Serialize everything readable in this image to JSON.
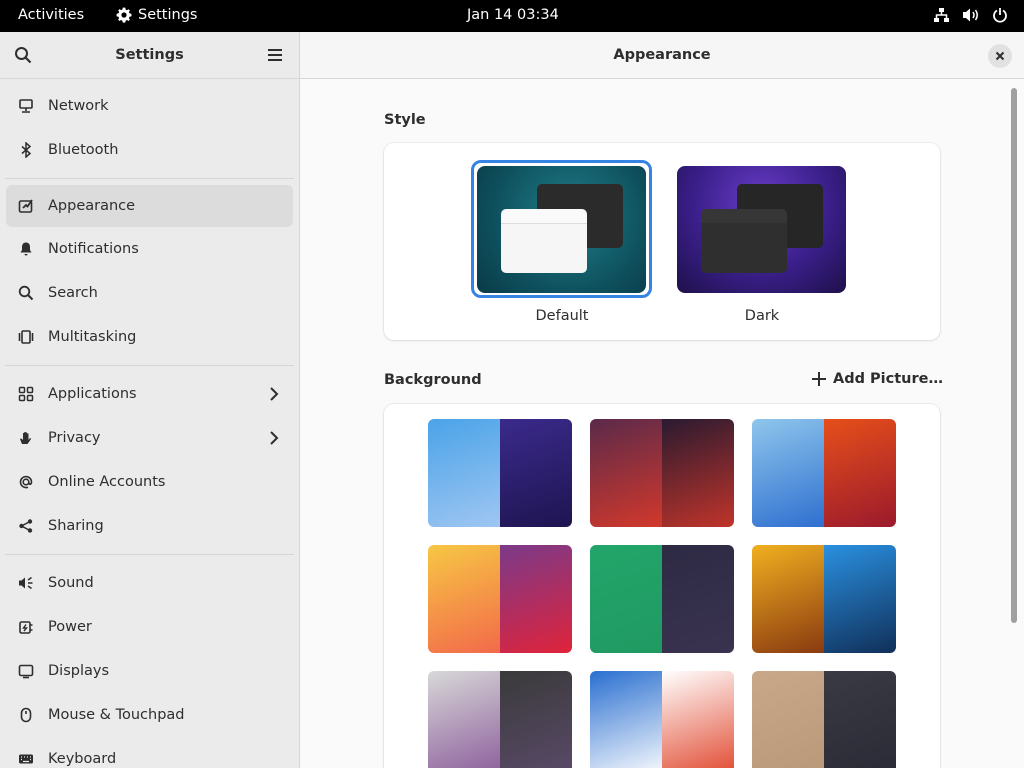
{
  "topbar": {
    "activities": "Activities",
    "app_name": "Settings",
    "clock": "Jan 14  03:34",
    "status_icons": [
      "network-icon",
      "volume-icon",
      "power-icon"
    ]
  },
  "sidebar": {
    "title": "Settings",
    "items": [
      {
        "label": "Network",
        "icon": "network-icon"
      },
      {
        "label": "Bluetooth",
        "icon": "bluetooth-icon"
      },
      {
        "label": "Appearance",
        "icon": "appearance-icon",
        "active": true
      },
      {
        "label": "Notifications",
        "icon": "bell-icon"
      },
      {
        "label": "Search",
        "icon": "search-icon"
      },
      {
        "label": "Multitasking",
        "icon": "multitasking-icon"
      },
      {
        "label": "Applications",
        "icon": "apps-grid-icon",
        "chevron": true
      },
      {
        "label": "Privacy",
        "icon": "hand-icon",
        "chevron": true
      },
      {
        "label": "Online Accounts",
        "icon": "at-icon"
      },
      {
        "label": "Sharing",
        "icon": "share-icon"
      },
      {
        "label": "Sound",
        "icon": "sound-icon"
      },
      {
        "label": "Power",
        "icon": "power-plug-icon"
      },
      {
        "label": "Displays",
        "icon": "display-icon"
      },
      {
        "label": "Mouse & Touchpad",
        "icon": "mouse-icon"
      },
      {
        "label": "Keyboard",
        "icon": "keyboard-icon"
      }
    ]
  },
  "content": {
    "title": "Appearance",
    "style_label": "Style",
    "style_options": [
      {
        "label": "Default",
        "selected": true
      },
      {
        "label": "Dark",
        "selected": false
      }
    ],
    "background_label": "Background",
    "add_picture_label": "Add Picture…",
    "wallpapers": [
      {
        "name": "blue-prism",
        "left": [
          "#4aa3e8",
          "#9fc6f2"
        ],
        "right": [
          "#3b2a8c",
          "#1e1450"
        ]
      },
      {
        "name": "red-layers",
        "left": [
          "#5a2a4a",
          "#d2382b"
        ],
        "right": [
          "#2a1a30",
          "#c0342a"
        ]
      },
      {
        "name": "drip",
        "left": [
          "#8fc6ec",
          "#2f6fd0"
        ],
        "right": [
          "#e64f1a",
          "#9b1a2c"
        ]
      },
      {
        "name": "amber-gradient",
        "left": [
          "#f7c744",
          "#f26a4a"
        ],
        "right": [
          "#7a3a8a",
          "#e0233a"
        ]
      },
      {
        "name": "green-dots",
        "left": [
          "#23a56a",
          "#1f9a62"
        ],
        "right": [
          "#2d2a44",
          "#3a3350"
        ]
      },
      {
        "name": "sequins",
        "left": [
          "#f0b020",
          "#8a3a10"
        ],
        "right": [
          "#2a90e0",
          "#10305a"
        ]
      },
      {
        "name": "isometric",
        "left": [
          "#d8d8d8",
          "#8a5a9a"
        ],
        "right": [
          "#3a3a3a",
          "#5a4a6a"
        ]
      },
      {
        "name": "stripes",
        "left": [
          "#2a6fd0",
          "#ffffff"
        ],
        "right": [
          "#ffffff",
          "#e0442a"
        ]
      },
      {
        "name": "toys",
        "left": [
          "#c8a888",
          "#b89878"
        ],
        "right": [
          "#3a3a44",
          "#2a2a36"
        ]
      }
    ]
  },
  "colors": {
    "accent": "#3584e4",
    "sidebar_bg": "#ebebeb",
    "topbar_bg": "#000000"
  }
}
